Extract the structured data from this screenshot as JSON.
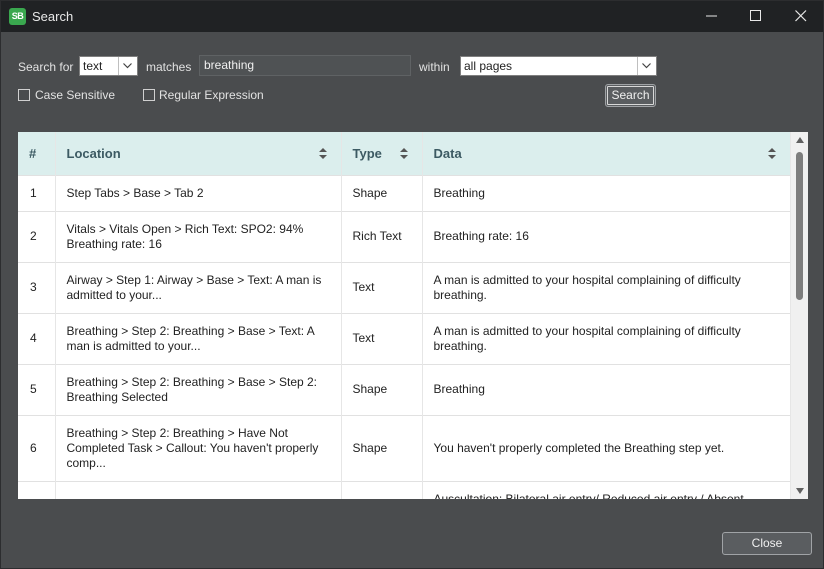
{
  "window": {
    "title": "Search",
    "app_icon_text": "SB"
  },
  "form": {
    "search_for_label": "Search for",
    "search_for_value": "text",
    "matches_label": "matches",
    "query": "breathing",
    "within_label": "within",
    "within_value": "all pages",
    "case_sensitive_label": "Case Sensitive",
    "regex_label": "Regular Expression",
    "search_button": "Search"
  },
  "table": {
    "columns": [
      "#",
      "Location",
      "Type",
      "Data"
    ],
    "rows": [
      {
        "num": "1",
        "location": "Step Tabs > Base > Tab 2",
        "type": "Shape",
        "data": "Breathing"
      },
      {
        "num": "2",
        "location": "Vitals > Vitals Open > Rich Text: SPO2: 94% Breathing rate: 16",
        "type": "Rich Text",
        "data": "Breathing rate: 16"
      },
      {
        "num": "3",
        "location": "Airway > Step 1: Airway > Base > Text: A man is admitted to your...",
        "type": "Text",
        "data": "A man is admitted to your hospital complaining of difficulty breathing."
      },
      {
        "num": "4",
        "location": "Breathing > Step 2: Breathing > Base > Text: A man is admitted to your...",
        "type": "Text",
        "data": "A man is admitted to your hospital complaining of difficulty breathing."
      },
      {
        "num": "5",
        "location": "Breathing > Step 2: Breathing > Base > Step 2: Breathing Selected",
        "type": "Shape",
        "data": "Breathing"
      },
      {
        "num": "6",
        "location": "Breathing > Step 2: Breathing > Have Not Completed Task > Callout: You haven't properly comp...",
        "type": "Shape",
        "data": "You haven't properly completed the Breathing step yet."
      },
      {
        "num": "",
        "location": "",
        "type": "",
        "data": "Auscultation: Bilateral air entry/ Reduced air entry / Absent"
      }
    ]
  },
  "footer": {
    "close_button": "Close"
  },
  "colors": {
    "header_bg": "#dbeeed",
    "window_bg": "#4a4c4e",
    "titlebar_bg": "#202224",
    "app_icon": "#3aa84f"
  }
}
